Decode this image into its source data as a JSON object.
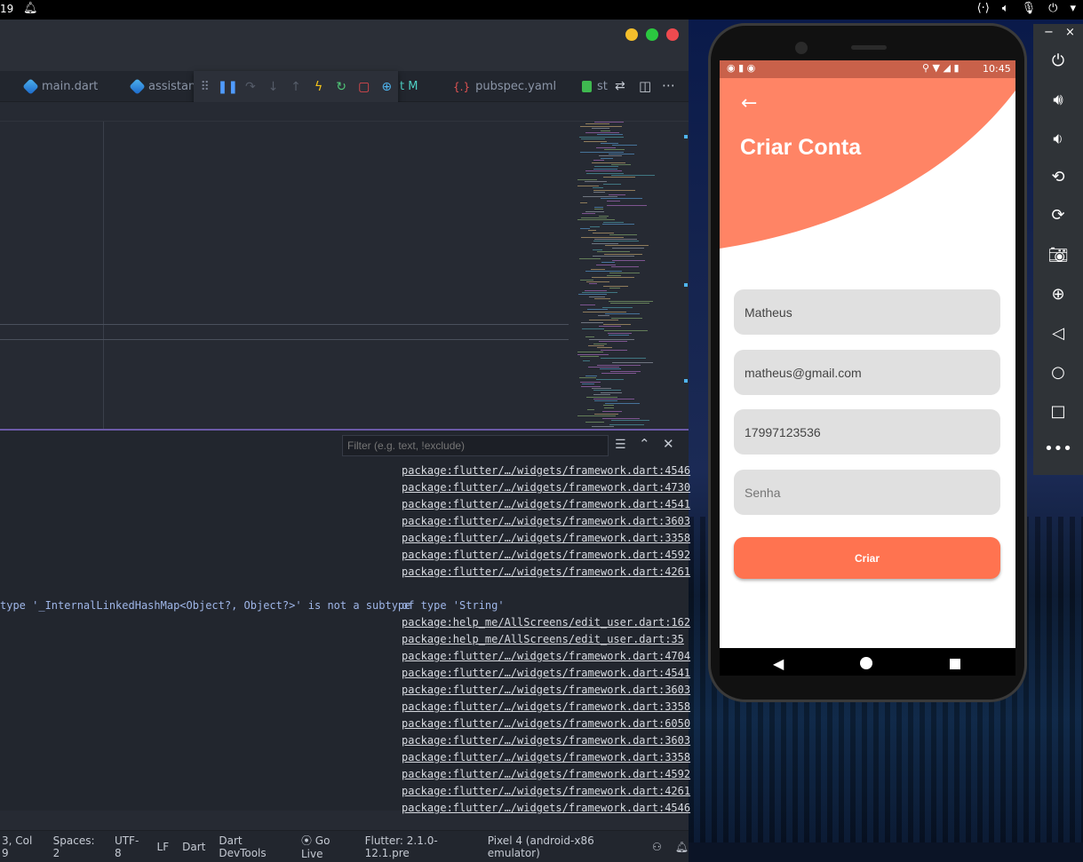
{
  "os_bar": {
    "clock": "19"
  },
  "tabs": [
    {
      "label": "main.dart"
    },
    {
      "label": "assistant"
    },
    {
      "label": "t M"
    },
    {
      "label": "pubspec.yaml"
    },
    {
      "label": "st"
    }
  ],
  "debug_panel": {
    "filter_placeholder": "Filter (e.g. text, !exclude)"
  },
  "console": {
    "links_top": [
      "package:flutter/…/widgets/framework.dart:4546",
      "package:flutter/…/widgets/framework.dart:4730",
      "package:flutter/…/widgets/framework.dart:4541",
      "package:flutter/…/widgets/framework.dart:3603",
      "package:flutter/…/widgets/framework.dart:3358",
      "package:flutter/…/widgets/framework.dart:4592",
      "package:flutter/…/widgets/framework.dart:4261"
    ],
    "error_prefix": "type '_InternalLinkedHashMap<Object?, Object?>' is not a subtype",
    "error_suffix": "of type 'String'",
    "links_bottom": [
      "package:help_me/AllScreens/edit_user.dart:162",
      " package:help_me/AllScreens/edit_user.dart:35",
      "package:flutter/…/widgets/framework.dart:4704",
      "package:flutter/…/widgets/framework.dart:4541",
      "package:flutter/…/widgets/framework.dart:3603",
      "package:flutter/…/widgets/framework.dart:3358",
      "package:flutter/…/widgets/framework.dart:6050",
      "package:flutter/…/widgets/framework.dart:3603",
      "package:flutter/…/widgets/framework.dart:3358",
      "package:flutter/…/widgets/framework.dart:4592",
      "package:flutter/…/widgets/framework.dart:4261",
      "package:flutter/…/widgets/framework.dart:4546"
    ]
  },
  "statusbar": {
    "position": "3, Col 9",
    "spaces": "Spaces: 2",
    "encoding": "UTF-8",
    "eol": "LF",
    "language": "Dart",
    "devtools": "Dart DevTools",
    "golive": "Go Live",
    "flutter": "Flutter: 2.1.0-12.1.pre",
    "device": "Pixel 4 (android-x86 emulator)"
  },
  "phone": {
    "time": "10:45",
    "title": "Criar Conta",
    "fields": {
      "name": "Matheus",
      "email": "matheus@gmail.com",
      "phone": "17997123536",
      "password_placeholder": "Senha"
    },
    "button_label": "Criar"
  },
  "colors": {
    "accent": "#ff8465",
    "button": "#ff7350",
    "editor_bg": "#262a33"
  }
}
